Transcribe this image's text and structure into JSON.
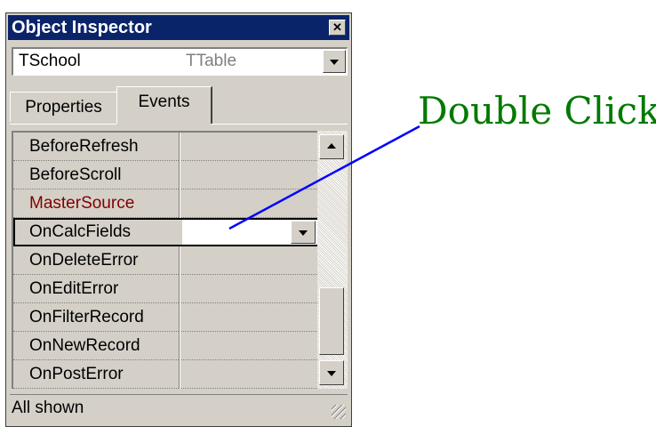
{
  "window": {
    "title": "Object Inspector"
  },
  "object_selector": {
    "name": "TSchool",
    "type": "TTable"
  },
  "tabs": [
    {
      "label": "Properties"
    },
    {
      "label": "Events",
      "selected": true
    }
  ],
  "events": [
    {
      "name": "BeforeRefresh",
      "value": ""
    },
    {
      "name": "BeforeScroll",
      "value": ""
    },
    {
      "name": "MasterSource",
      "value": "",
      "color": "#800000"
    },
    {
      "name": "OnCalcFields",
      "value": "",
      "selected": true
    },
    {
      "name": "OnDeleteError",
      "value": ""
    },
    {
      "name": "OnEditError",
      "value": ""
    },
    {
      "name": "OnFilterRecord",
      "value": ""
    },
    {
      "name": "OnNewRecord",
      "value": ""
    },
    {
      "name": "OnPostError",
      "value": ""
    }
  ],
  "status": {
    "text": "All shown"
  },
  "annotation": {
    "text": "Double Click",
    "color": "#007a00",
    "line_color": "#0000ff"
  },
  "colors": {
    "title_bg": "#0a246a",
    "face": "#d4d0c8",
    "highlight_text": "#800000"
  }
}
